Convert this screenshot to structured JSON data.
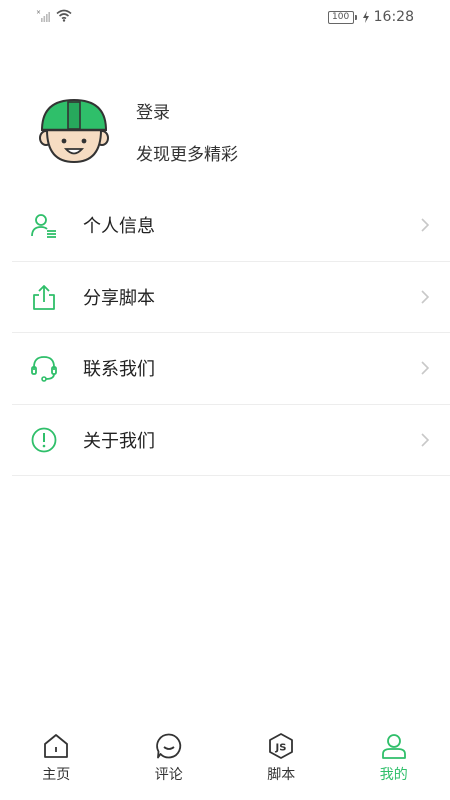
{
  "status_bar": {
    "battery": "100",
    "time": "16:28"
  },
  "profile": {
    "login": "登录",
    "subtitle": "发现更多精彩"
  },
  "menu": {
    "items": [
      {
        "label": "个人信息",
        "icon": "person-info-icon"
      },
      {
        "label": "分享脚本",
        "icon": "share-icon"
      },
      {
        "label": "联系我们",
        "icon": "headset-icon"
      },
      {
        "label": "关于我们",
        "icon": "info-circle-icon"
      }
    ]
  },
  "bottom_nav": {
    "items": [
      {
        "label": "主页",
        "icon": "home-icon"
      },
      {
        "label": "评论",
        "icon": "comment-icon"
      },
      {
        "label": "脚本",
        "icon": "js-script-icon"
      },
      {
        "label": "我的",
        "icon": "user-icon",
        "active": true
      }
    ]
  },
  "colors": {
    "accent": "#2fbf6a",
    "text": "#222222",
    "divider": "#ededed"
  }
}
